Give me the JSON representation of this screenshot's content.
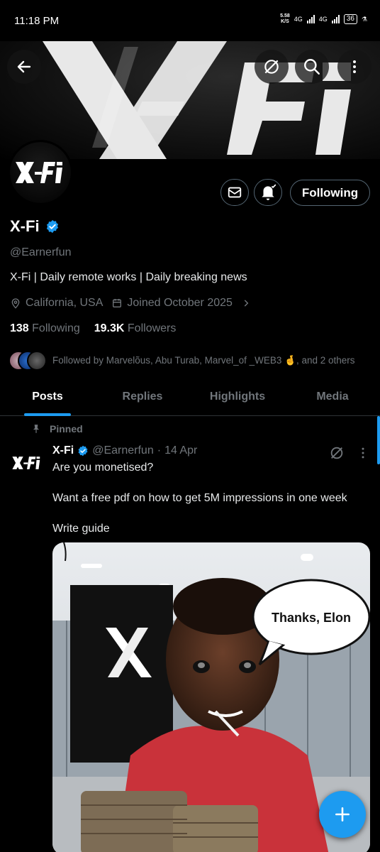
{
  "status_bar": {
    "time": "11:18 PM",
    "net_speed_top": "5.58",
    "net_speed_bottom": "K/S",
    "sig1": "4G",
    "sig2": "4G",
    "battery": "36"
  },
  "profile": {
    "name": "X-Fi",
    "handle": "@Earnerfun",
    "bio": "X-Fi | Daily remote works | Daily breaking news",
    "location": "California, USA",
    "joined": "Joined October 2025",
    "following_count": "138",
    "following_label": "Following",
    "followers_count": "19.3K",
    "followers_label": "Followers",
    "followed_by": "Followed by Marvelõus, Abu Turab, Marvel_of _WEB3 🤞, and 2 others",
    "follow_button": "Following",
    "verified": true
  },
  "tabs": [
    {
      "label": "Posts",
      "active": true
    },
    {
      "label": "Replies",
      "active": false
    },
    {
      "label": "Highlights",
      "active": false
    },
    {
      "label": "Media",
      "active": false
    }
  ],
  "pinned_post": {
    "pinned_label": "Pinned",
    "author": "X-Fi",
    "handle": "@Earnerfun",
    "separator": "·",
    "date": "14 Apr",
    "line1": "Are you monetised?",
    "line2": "Want a free pdf on how to get 5M impressions in one week",
    "line3": "Write guide",
    "image_caption": "Thanks, Elon"
  },
  "colors": {
    "accent": "#1d9bf0",
    "muted": "#71767b",
    "border": "#536471"
  },
  "icons": [
    "back-arrow-icon",
    "grok-icon",
    "search-icon",
    "more-vertical-icon",
    "message-icon",
    "bell-icon",
    "location-icon",
    "calendar-icon",
    "chevron-right-icon",
    "verified-icon",
    "pin-icon",
    "compose-plus-icon"
  ]
}
